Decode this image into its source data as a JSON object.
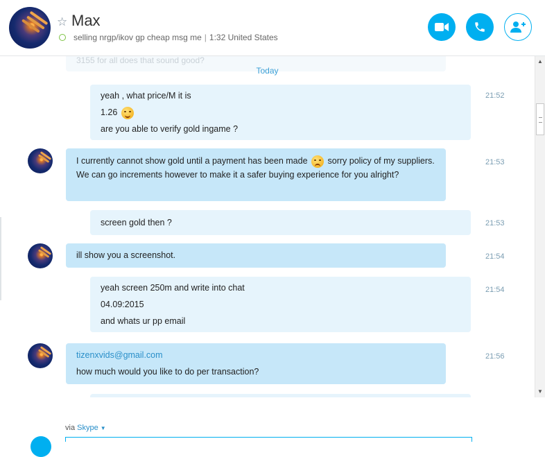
{
  "header": {
    "name": "Max",
    "mood": "selling nrgp/ikov gp cheap msg me",
    "local_time": "1:32 United States",
    "buttons": [
      "video-call",
      "audio-call",
      "add-participant"
    ],
    "accent_color": "#00aff0"
  },
  "chat": {
    "ghost_text": "3155 for all does that sound good?",
    "day_divider": "Today",
    "messages": [
      {
        "dir": "out",
        "time": "21:52",
        "lines": [
          "yeah , what price/M it is",
          "1.26",
          "are you able to verify gold ingame ?"
        ]
      },
      {
        "dir": "in",
        "time": "21:53",
        "text_a": "I currently cannot show gold until a payment has been made",
        "text_b": "sorry policy of my suppliers. We can go increments however to make it a safer buying experience for you alright?"
      },
      {
        "dir": "out",
        "time": "21:53",
        "lines": [
          "screen gold then ?"
        ]
      },
      {
        "dir": "in",
        "time": "21:54",
        "lines": [
          "ill show you a screenshot."
        ]
      },
      {
        "dir": "out",
        "time": "21:54",
        "lines": [
          "yeah screen 250m and  write into chat",
          "04.09:2015",
          "and whats ur pp email"
        ]
      },
      {
        "dir": "in",
        "time": "21:56",
        "email": "tizenxvids@gmail.com",
        "lines": [
          "how much would you like to do per transaction?"
        ]
      }
    ]
  },
  "composer": {
    "via_label": "via",
    "service": "Skype"
  }
}
